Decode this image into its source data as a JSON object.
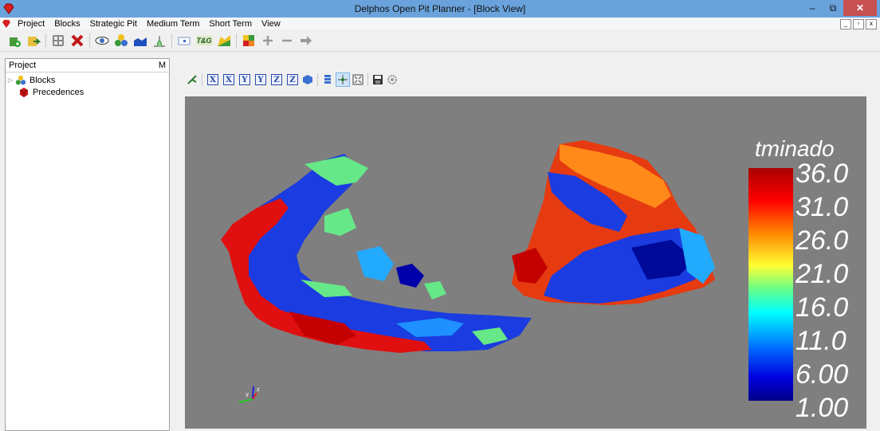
{
  "window": {
    "title": "Delphos Open Pit Planner - [Block View]",
    "buttons": [
      "–",
      "⧉",
      "✕"
    ],
    "mdi_buttons": [
      "_",
      "▫",
      "x"
    ]
  },
  "menu": {
    "items": [
      "Project",
      "Blocks",
      "Strategic Pit",
      "Medium Term",
      "Short Term",
      "View"
    ]
  },
  "toolbar": {
    "tg_label": "T&G",
    "icons": [
      "new-project-icon",
      "open-project-icon",
      "calculator-icon",
      "delete-icon",
      "eye-icon",
      "blocks-icon",
      "area-chart-icon",
      "histogram-icon",
      "sheet-icon",
      "tg-icon",
      "pit-icon",
      "color-icon",
      "plus-icon",
      "minus-icon",
      "arrow-right-icon"
    ]
  },
  "project_panel": {
    "header": "Project",
    "header_right": "M",
    "items": [
      {
        "label": "Blocks",
        "icon": "blocks-icon"
      },
      {
        "label": "Precedences",
        "icon": "cube-red-icon"
      }
    ]
  },
  "viewer_toolbar": {
    "axis_buttons": [
      "X",
      "X",
      "Y",
      "Y",
      "Z",
      "Z"
    ]
  },
  "legend": {
    "title": "tminado",
    "labels": [
      "36.0",
      "31.0",
      "26.0",
      "21.0",
      "16.0",
      "11.0",
      "6.00",
      "1.00"
    ]
  },
  "axes_triad": {
    "x": "x",
    "y": "y",
    "z": "z"
  },
  "colors": {
    "titlebar": "#6aa3dc",
    "canvas": "#7f7f7f",
    "close_button": "#c75050"
  }
}
